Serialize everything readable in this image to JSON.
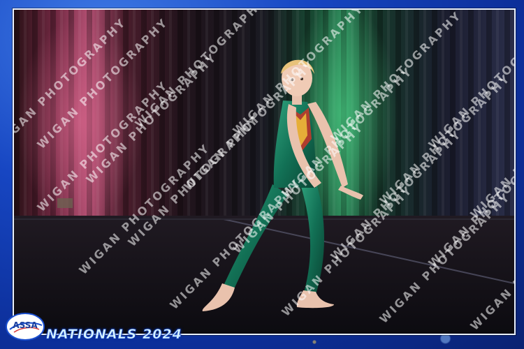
{
  "image": {
    "subject": "young-dancer-in-green-unitard-on-stage",
    "frame_color": "#1746c2",
    "accent_gold": "#f3c64a"
  },
  "watermark": {
    "text": "WIGAN PHOTOGRAPHY"
  },
  "logo": {
    "text": "ASSA"
  },
  "event": {
    "title": "NATIONALS 2024"
  }
}
